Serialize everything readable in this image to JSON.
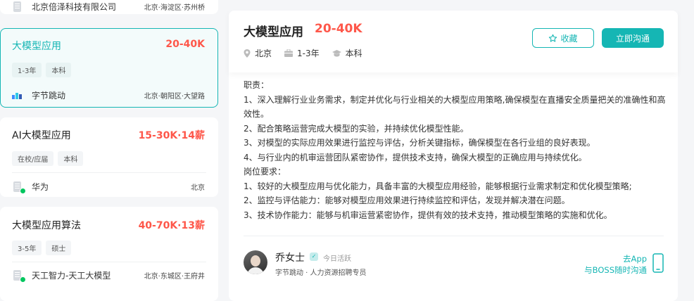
{
  "job_list": [
    {
      "company": "北京倍泽科技有限公司",
      "location": "北京·海淀区·苏州桥"
    },
    {
      "title": "大模型应用",
      "salary": "20-40K",
      "tags": [
        "1-3年",
        "本科"
      ],
      "company": "字节跳动",
      "location": "北京·朝阳区·大望路"
    },
    {
      "title": "AI大模型应用",
      "salary": "15-30K·14薪",
      "tags": [
        "在校/应届",
        "本科"
      ],
      "company": "华为",
      "location": "北京"
    },
    {
      "title": "大模型应用算法",
      "salary": "40-70K·13薪",
      "tags": [
        "3-5年",
        "硕士"
      ],
      "company": "天工智力-天工大模型",
      "location": "北京·东城区·王府井"
    }
  ],
  "detail": {
    "title": "大模型应用",
    "salary": "20-40K",
    "city": "北京",
    "experience": "1-3年",
    "degree": "本科",
    "favorite_label": "收藏",
    "chat_label": "立即沟通",
    "description_lines": [
      "职责：",
      "1、深入理解行业业务需求，制定并优化与行业相关的大模型应用策略,确保模型在直播安全质量把关的准确性和高",
      "效性。",
      "2、配合策略运营完成大模型的实验，并持续优化模型性能。",
      "3、对模型的实际应用效果进行监控与评估，分析关键指标，确保模型在各行业组的良好表现。",
      "4、与行业内的机审运营团队紧密协作，提供技术支持，确保大模型的正确应用与持续优化。",
      "岗位要求：",
      "1、较好的大模型应用与优化能力，具备丰富的大模型应用经验，能够根据行业需求制定和优化模型策略;",
      "2、监控与评估能力：能够对模型应用效果进行持续监控和评估，发现并解决潜在问题。",
      "3、技术协作能力：能够与机审运营紧密协作，提供有效的技术支持，推动模型策略的实施和优化。"
    ],
    "recruiter": {
      "name": "乔女士",
      "status": "今日活跃",
      "subtitle": "字节跳动 · 人力资源招聘专员"
    },
    "app_link_line1": "去App",
    "app_link_line2": "与BOSS随时沟通"
  },
  "colors": {
    "accent": "#15b6b4",
    "salary": "#fe574a",
    "active_dot": "#00c65f"
  },
  "icons": [
    "building-icon",
    "location-icon",
    "briefcase-icon",
    "graduation-cap-icon",
    "star-icon",
    "verified-icon",
    "phone-icon"
  ]
}
